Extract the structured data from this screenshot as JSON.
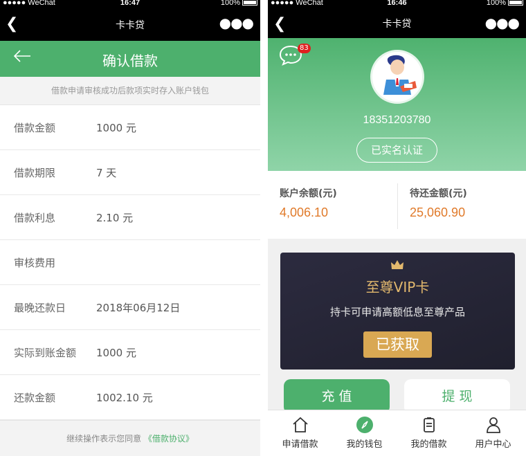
{
  "left": {
    "status": {
      "carrier": "●●●●● WeChat",
      "time": "16:47",
      "battery": "100%"
    },
    "wechat_title": "卡卡贷",
    "header_title": "确认借款",
    "notice": "借款申请审核成功后款项实时存入账户钱包",
    "rows": [
      {
        "label": "借款金额",
        "value": "1000 元"
      },
      {
        "label": "借款期限",
        "value": "7 天"
      },
      {
        "label": "借款利息",
        "value": "2.10 元"
      },
      {
        "label": "审核费用",
        "value": ""
      },
      {
        "label": "最晚还款日",
        "value": "2018年06月12日"
      },
      {
        "label": "实际到账金额",
        "value": "1000 元"
      },
      {
        "label": "还款金额",
        "value": "1002.10 元"
      }
    ],
    "footer_text": "继续操作表示您同意",
    "footer_link": "《借款协议》"
  },
  "right": {
    "status": {
      "carrier": "●●●●● WeChat",
      "time": "16:46",
      "battery": "100%"
    },
    "wechat_title": "卡卡贷",
    "message_badge": "83",
    "phone_number": "18351203780",
    "verified_label": "已实名认证",
    "balance_label": "账户余额(元)",
    "balance_value": "4,006.10",
    "due_label": "待还金额(元)",
    "due_value": "25,060.90",
    "vip": {
      "title": "至尊VIP卡",
      "desc": "持卡可申请高额低息至尊产品",
      "button": "已获取"
    },
    "recharge_label": "充 值",
    "withdraw_label": "提 现",
    "tabs": [
      {
        "label": "申请借款",
        "icon": "home-icon"
      },
      {
        "label": "我的钱包",
        "icon": "compass-icon"
      },
      {
        "label": "我的借款",
        "icon": "document-icon"
      },
      {
        "label": "用户中心",
        "icon": "user-icon"
      }
    ],
    "colors": {
      "primary_green": "#4db06d",
      "amount_orange": "#e07a2a",
      "vip_gold": "#d9a853"
    }
  }
}
